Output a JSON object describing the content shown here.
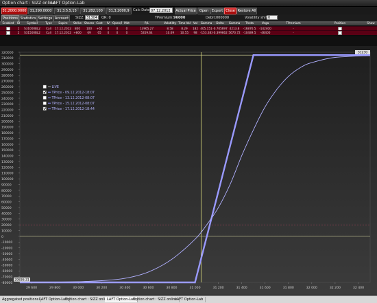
{
  "titlebar": {
    "title": "Option chart : SIZZ online",
    "subtitle": "LAFT Option-Lab"
  },
  "quotes": {
    "btn1": "31,2000.0000",
    "btn2": "31,290.0000",
    "btn3": "31,3.5,5,15",
    "btn4": "31,282,100",
    "btn5": "31,3,2000,9",
    "calc_date_label": "Calc Date",
    "calc_date_value": "07.12.2012",
    "actions": [
      "Actual Price",
      "Open",
      "Export",
      "Close",
      "Restore All"
    ]
  },
  "toolbar2": {
    "tabs": [
      "Positions",
      "Statistics",
      "Settings",
      "Account"
    ],
    "symbol_label": "SIZZ",
    "symbol_value": "31304",
    "qty_label": "QR: 0",
    "tpremium_label": "TPremium:",
    "tpremium_value": "96000",
    "debit_label": "Debit:",
    "debit_value": "000000",
    "vol_shift_label": "Volatility shift:",
    "vol_shift_value": "0"
  },
  "grid": {
    "headers": [
      "Enabled",
      "ID",
      "Symbol",
      "Type",
      "Expire",
      "Strike",
      "Shares",
      "Cost",
      "IV",
      "Open/Price",
      "Mkt",
      "P/L",
      "Volatility",
      "Time Val",
      "Vol",
      "Gamma",
      "Delta",
      "Gamma",
      "Theta",
      "Vega",
      "TPremium",
      "Position",
      "Show"
    ],
    "rows": [
      [
        "",
        "1",
        "S31000BL2",
        "Call",
        "17.12.2012",
        "800",
        "100",
        "+65",
        "0",
        "0",
        "0",
        "13965.27",
        "8.58",
        "8.29",
        "182",
        "405.151",
        "-0.705697",
        "4213.8",
        "-16876.5",
        "-142400",
        "-",
        "",
        ""
      ],
      [
        "",
        "2",
        "S31500BL2",
        "Call",
        "17.12.2012",
        "+800",
        "69",
        "65",
        "0",
        "0",
        "0",
        "5359.64",
        "10.09",
        "10.55",
        "98",
        "-153.383",
        "-0.399662",
        "5670.72",
        "-10489.5",
        "-46400",
        "-",
        "",
        ""
      ]
    ]
  },
  "chart_data": {
    "type": "line",
    "x_ticks": [
      "29 600",
      "29 800",
      "30 000",
      "30 200",
      "30 400",
      "30 600",
      "30 800",
      "31 000",
      "31 200",
      "31 400",
      "31 600",
      "31 800",
      "32 000",
      "32 200",
      "32 400"
    ],
    "y_ticks": [
      "320000",
      "310000",
      "300000",
      "290000",
      "280000",
      "270000",
      "260000",
      "250000",
      "240000",
      "230000",
      "220000",
      "210000",
      "200000",
      "190000",
      "180000",
      "170000",
      "160000",
      "150000",
      "140000",
      "130000",
      "120000",
      "110000",
      "100000",
      "90000",
      "80000",
      "70000",
      "60000",
      "50000",
      "40000",
      "30000",
      "20000",
      "10000",
      "0",
      "-10000",
      "-20000",
      "-30000",
      "-40000",
      "-50000",
      "-60000",
      "-70000",
      "-80000"
    ],
    "xlim": [
      29500,
      32500
    ],
    "ylim": [
      -80000,
      320000
    ],
    "crosshair_x": 31052,
    "top_marker_label": "31230",
    "bottom_marker_label": "29836.31",
    "zero_line": 0,
    "premium_line": 20000,
    "legend": [
      {
        "name": "LIVE",
        "checked": false
      },
      {
        "name": "TPrice - 09.12.2012-18:07",
        "checked": true
      },
      {
        "name": "TPrice - 13.12.2012-08:07",
        "checked": false
      },
      {
        "name": "TPrice - 15.12.2012-08:07",
        "checked": false
      },
      {
        "name": "TPrice - 17.12.2012-18:44",
        "checked": true
      }
    ],
    "series": [
      {
        "name": "TPrice - 17.12.2012-18:44",
        "color": "#9a9aff",
        "style": "thick",
        "x": [
          29500,
          31000,
          31500,
          32500
        ],
        "y": [
          -80000,
          -80000,
          315000,
          315000
        ]
      },
      {
        "name": "TPrice - 09.12.2012-18:07",
        "color": "#b0b0ff",
        "style": "thin",
        "x": [
          29500,
          29800,
          30000,
          30200,
          30400,
          30600,
          30800,
          31000,
          31100,
          31200,
          31300,
          31400,
          31500,
          31600,
          31700,
          31800,
          31900,
          32000,
          32200,
          32500
        ],
        "y": [
          -80000,
          -79500,
          -78800,
          -77000,
          -73000,
          -62000,
          -40000,
          -5000,
          20000,
          50000,
          90000,
          140000,
          185000,
          225000,
          255000,
          278000,
          293000,
          302000,
          311000,
          314000
        ]
      }
    ]
  },
  "statusbar": {
    "tabs": [
      "Aggregated positions",
      "LAFT Option-Lab",
      "Option chart : SIZZ online",
      "LAFT Option-Lab",
      "Option chart : SIZZ online",
      "LAFT Option-Lab"
    ]
  },
  "colors": {
    "accent_red": "#cc2222",
    "grid_row": "#5a0014",
    "series_main": "#9a9aff",
    "crosshair": "#d4d47a",
    "premium_line": "#c04060"
  }
}
